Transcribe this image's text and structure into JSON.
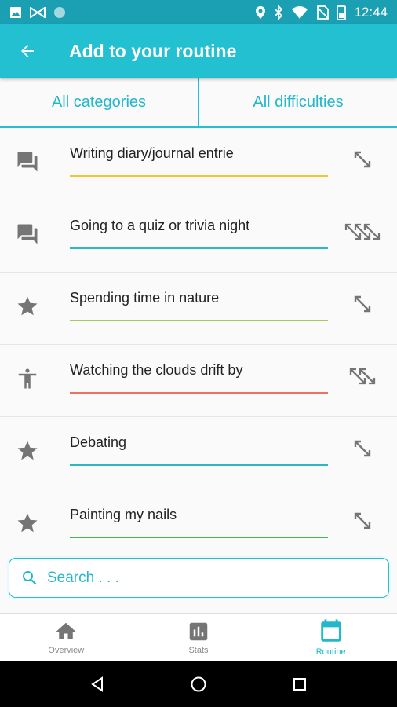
{
  "status_bar": {
    "time": "12:44",
    "icons": [
      "image-icon",
      "bowtie-icon",
      "circle-icon",
      "location-icon",
      "bluetooth-icon",
      "wifi-icon",
      "no-sim-icon",
      "battery-icon"
    ]
  },
  "app_bar": {
    "title": "Add to your routine",
    "back_icon": "arrow-back-icon"
  },
  "filters": {
    "categories_label": "All categories",
    "difficulties_label": "All difficulties"
  },
  "activities": [
    {
      "label": "Writing diary/journal entrie",
      "category_icon": "chat-icon",
      "line_color": "#f5c431",
      "difficulty": 1
    },
    {
      "label": "Going to a quiz or trivia night",
      "category_icon": "chat-icon",
      "line_color": "#2bb8c4",
      "difficulty": 3
    },
    {
      "label": "Spending time in nature",
      "category_icon": "star-icon",
      "line_color": "#a6c85a",
      "difficulty": 1
    },
    {
      "label": "Watching the clouds drift by",
      "category_icon": "person-icon",
      "line_color": "#e9735e",
      "difficulty": 2
    },
    {
      "label": "Debating",
      "category_icon": "star-icon",
      "line_color": "#2bb8c4",
      "difficulty": 1
    },
    {
      "label": "Painting my nails",
      "category_icon": "star-icon",
      "line_color": "#45b84a",
      "difficulty": 1
    }
  ],
  "search": {
    "placeholder": "Search . . ."
  },
  "bottom_nav": {
    "items": [
      {
        "label": "Overview",
        "icon": "home-icon",
        "active": false
      },
      {
        "label": "Stats",
        "icon": "stats-icon",
        "active": false
      },
      {
        "label": "Routine",
        "icon": "calendar-icon",
        "active": true
      }
    ]
  },
  "colors": {
    "primary": "#22c0d1",
    "status_bar": "#1a9fb3",
    "icon_gray": "#757575",
    "active": "#22b8c9"
  }
}
